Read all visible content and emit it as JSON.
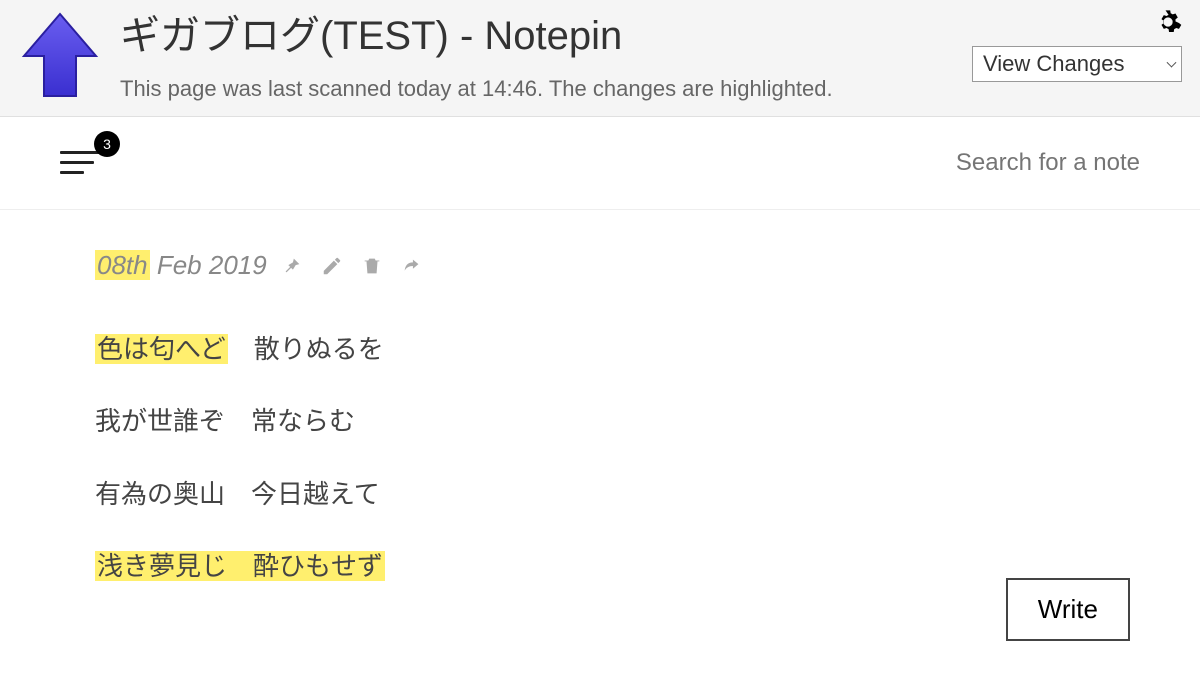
{
  "banner": {
    "title": "ギガブログ(TEST) - Notepin",
    "sub": "This page was last scanned today at 14:46. The changes are highlighted.",
    "dropdown_label": "View Changes"
  },
  "appbar": {
    "badge_count": "3",
    "search_placeholder": "Search for a note"
  },
  "note": {
    "date_day": "08th",
    "date_rest": " Feb 2019",
    "lines": {
      "l1a": "色は匂へど",
      "l1b": "　散りぬるを",
      "l2": "我が世誰ぞ　常ならむ",
      "l3": "有為の奥山　今日越えて",
      "l4": "浅き夢見じ　酔ひもせず"
    }
  },
  "write_label": "Write"
}
